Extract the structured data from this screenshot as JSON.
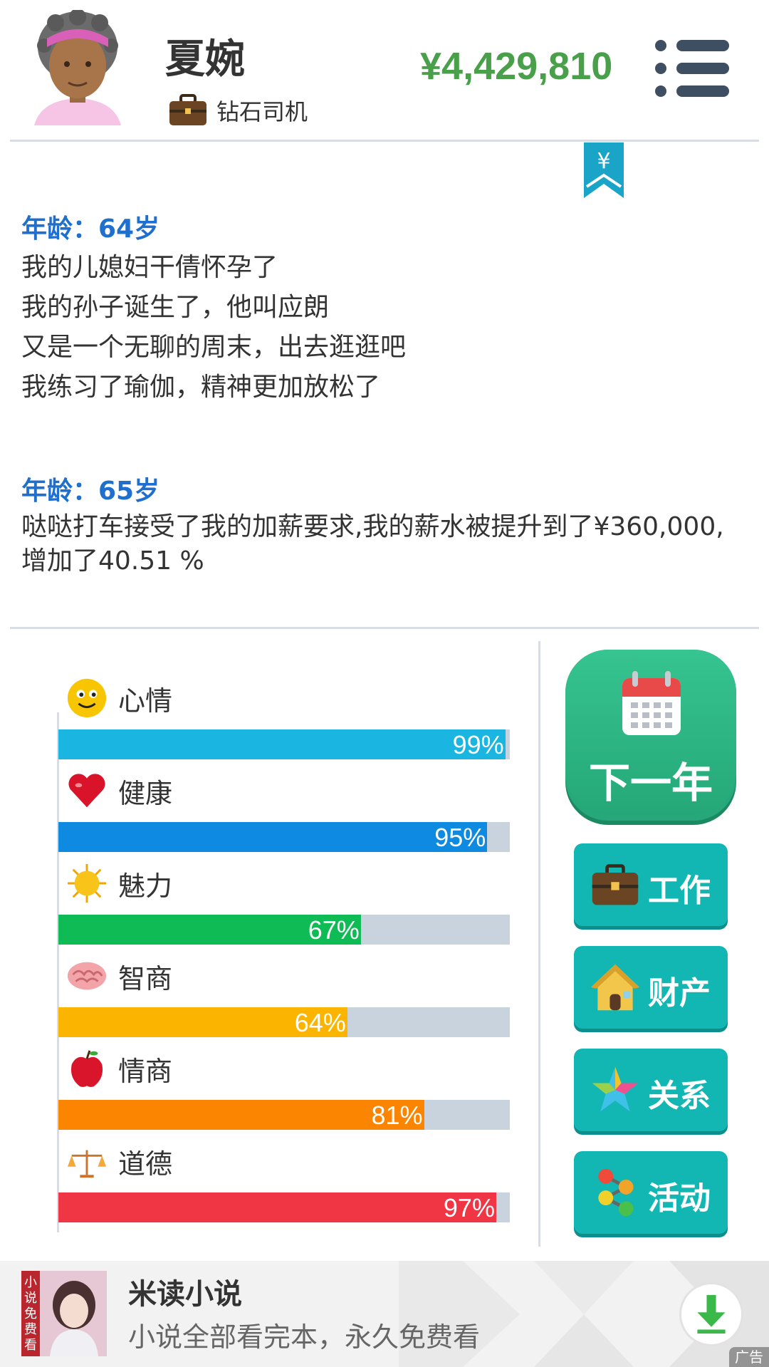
{
  "header": {
    "name": "夏婉",
    "job": "钻石司机",
    "money": "¥4,429,810",
    "ribbon_symbol": "¥"
  },
  "log": [
    {
      "age": "年龄：64岁",
      "lines": [
        "我的儿媳妇干倩怀孕了",
        "我的孙子诞生了，他叫应朗",
        "又是一个无聊的周末，出去逛逛吧",
        "我练习了瑜伽，精神更加放松了"
      ]
    },
    {
      "age": "年龄：65岁",
      "lines": [
        "哒哒打车接受了我的加薪要求,我的薪水被提升到了¥360,000,增加了40.51 %"
      ]
    }
  ],
  "stats": [
    {
      "label": "心情",
      "value": 99,
      "pct": "99%",
      "color": "#1ab5e0",
      "icon": "smiley-icon"
    },
    {
      "label": "健康",
      "value": 95,
      "pct": "95%",
      "color": "#0e8ae0",
      "icon": "heart-icon"
    },
    {
      "label": "魅力",
      "value": 67,
      "pct": "67%",
      "color": "#0fbb55",
      "icon": "sun-icon"
    },
    {
      "label": "智商",
      "value": 64,
      "pct": "64%",
      "color": "#fbb400",
      "icon": "brain-icon"
    },
    {
      "label": "情商",
      "value": 81,
      "pct": "81%",
      "color": "#fb8400",
      "icon": "apple-icon"
    },
    {
      "label": "道德",
      "value": 97,
      "pct": "97%",
      "color": "#f03545",
      "icon": "scales-icon"
    }
  ],
  "actions": {
    "next_year": "下一年",
    "work": "工作",
    "property": "财产",
    "relations": "关系",
    "activities": "活动"
  },
  "ad": {
    "title": "米读小说",
    "desc": "小说全部看完本，永久免费看",
    "cover_text": "小说免费看",
    "tag": "广告"
  }
}
